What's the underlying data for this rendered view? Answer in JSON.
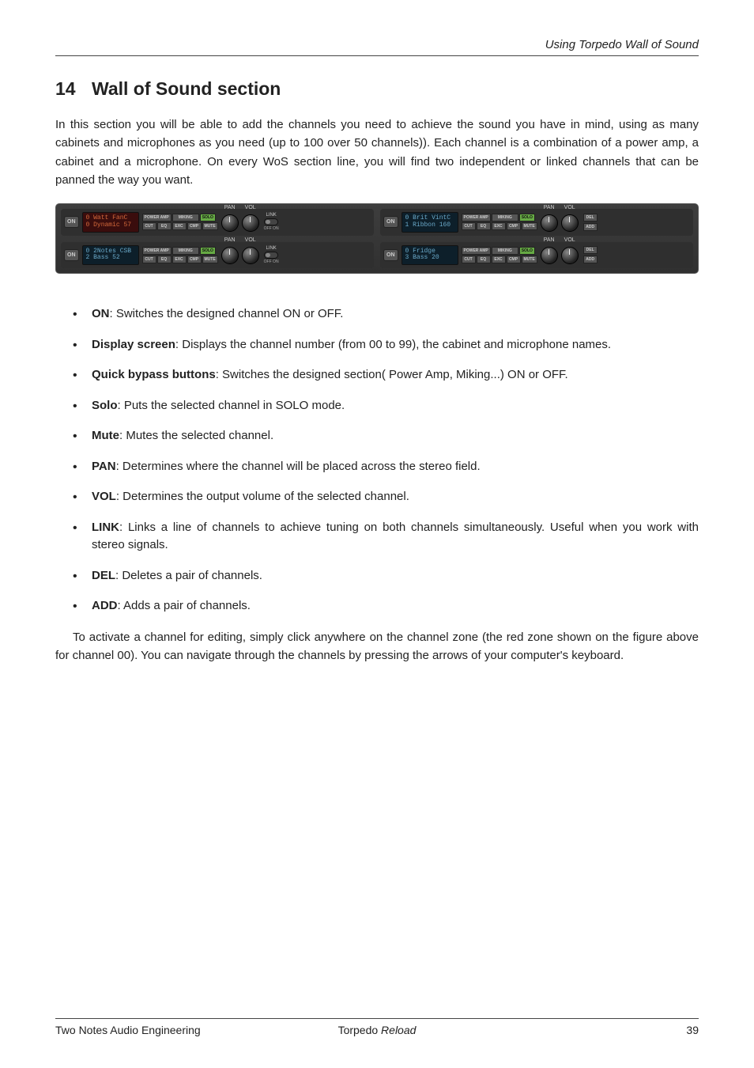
{
  "header": {
    "running": "Using Torpedo Wall of Sound"
  },
  "section": {
    "number": "14",
    "title": "Wall of Sound section"
  },
  "intro": "In this section you will be able to add the channels you need to achieve the sound you have in mind, using as many cabinets and microphones as you need (up to 100 over 50 channels)). Each channel is a combination of a power amp, a cabinet and a microphone. On every WoS section line, you will find two independent or linked channels that can be panned the way you want.",
  "figure": {
    "labels": {
      "on": "ON",
      "power_amp": "POWER AMP",
      "miking": "MIKING",
      "solo": "SOLO",
      "cut": "CUT",
      "eq": "EQ",
      "exc": "EXC",
      "cmp": "CMP",
      "mute": "MUTE",
      "pan": "PAN",
      "vol": "VOL",
      "link": "LINK",
      "off_on": "OFF ON",
      "del": "DEL",
      "add": "ADD"
    },
    "channels": [
      {
        "line1": "0 Watt FanC",
        "line2": "0 Dynamic 57",
        "style": "red"
      },
      {
        "line1": "0 Brit VintC",
        "line2": "1 Ribbon 160",
        "style": "blue"
      },
      {
        "line1": "0 2Notes CSB",
        "line2": "2 Bass 52",
        "style": "blue"
      },
      {
        "line1": "0 Fridge",
        "line2": "3 Bass 20",
        "style": "blue"
      }
    ]
  },
  "definitions": [
    {
      "term": "ON",
      "desc": ": Switches the designed channel ON or OFF."
    },
    {
      "term": "Display screen",
      "desc": ": Displays the channel number (from 00 to 99), the cabinet and microphone names."
    },
    {
      "term": "Quick bypass buttons",
      "desc": ": Switches the designed section( Power Amp, Miking...) ON or OFF."
    },
    {
      "term": "Solo",
      "desc": ": Puts the selected channel in SOLO mode."
    },
    {
      "term": "Mute",
      "desc": ": Mutes the selected channel."
    },
    {
      "term": "PAN",
      "desc": ": Determines where the channel will be placed across the stereo field."
    },
    {
      "term": "VOL",
      "desc": ": Determines the output volume of the selected channel."
    },
    {
      "term": "LINK",
      "desc": ": Links a line of channels to achieve tuning on both channels simultaneously. Useful when you work with stereo signals."
    },
    {
      "term": "DEL",
      "desc": ": Deletes a pair of channels."
    },
    {
      "term": "ADD",
      "desc": ": Adds a pair of channels."
    }
  ],
  "outro": "To activate a channel for editing, simply click anywhere on the channel zone (the red zone shown on the figure above for channel 00). You can navigate through the channels by pressing the arrows of your computer's keyboard.",
  "footer": {
    "left": "Two Notes Audio Engineering",
    "center_prefix": "Torpedo ",
    "center_em": "Reload",
    "page": "39"
  }
}
